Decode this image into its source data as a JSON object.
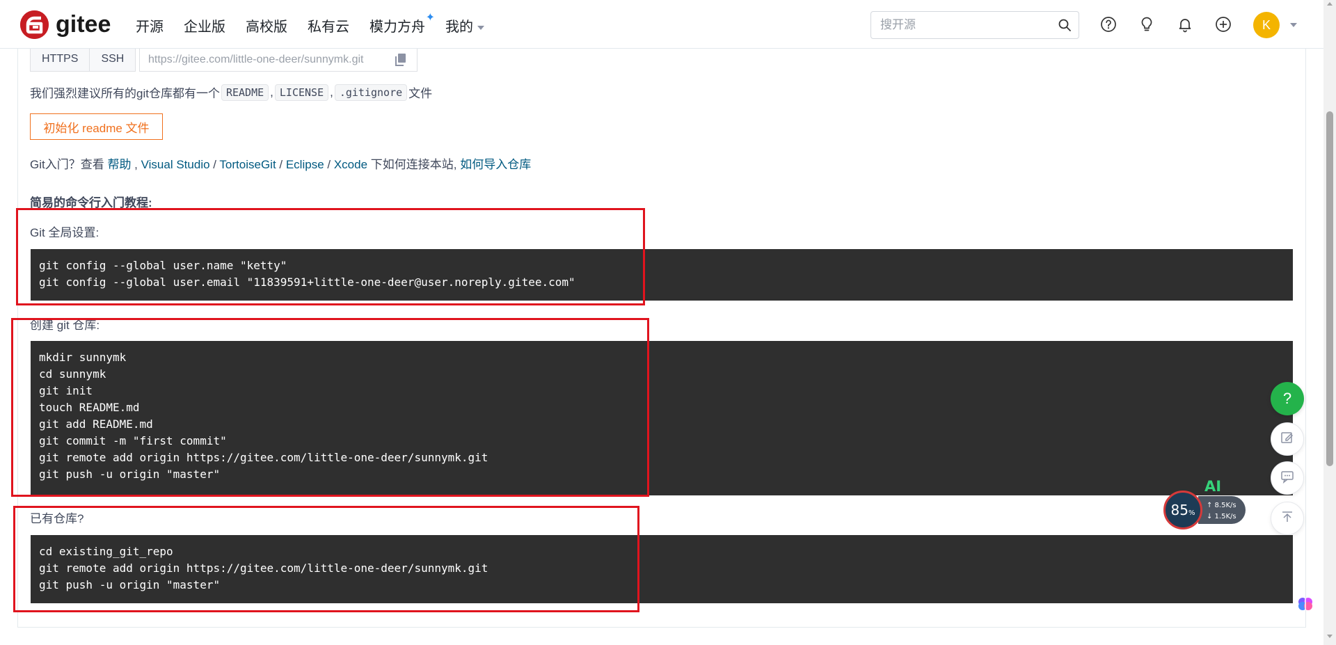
{
  "header": {
    "logo_text": "gitee",
    "nav": [
      {
        "label": "开源"
      },
      {
        "label": "企业版"
      },
      {
        "label": "高校版"
      },
      {
        "label": "私有云"
      },
      {
        "label": "模力方舟",
        "badge": "✦"
      },
      {
        "label": "我的"
      }
    ],
    "search_placeholder": "搜开源",
    "avatar_letter": "K"
  },
  "clone": {
    "https_label": "HTTPS",
    "ssh_label": "SSH",
    "url": "https://gitee.com/little-one-deer/sunnymk.git"
  },
  "recommend": {
    "prefix": "我们强烈建议所有的git仓库都有一个",
    "file1": "README",
    "sep1": ",",
    "file2": "LICENSE",
    "sep2": ",",
    "file3": ".gitignore",
    "suffix": "文件"
  },
  "init_button": "初始化 readme 文件",
  "links": {
    "prefix": "Git入门？查看 ",
    "help": "帮助",
    "sep0": " , ",
    "vs": "Visual Studio",
    "sep1": " / ",
    "tortoise": "TortoiseGit",
    "sep2": " / ",
    "eclipse": "Eclipse",
    "sep3": " / ",
    "xcode": "Xcode",
    "middle": " 下如何连接本站, ",
    "import": "如何导入仓库"
  },
  "tutorial": {
    "title": "简易的命令行入门教程:",
    "global_label": "Git 全局设置:",
    "global_code": [
      "git config --global user.name \"ketty\"",
      "git config --global user.email \"11839591+little-one-deer@user.noreply.gitee.com\""
    ],
    "create_label": "创建 git 仓库:",
    "create_code": [
      "mkdir sunnymk",
      "cd sunnymk",
      "git init",
      "touch README.md",
      "git add README.md",
      "git commit -m \"first commit\"",
      "git remote add origin https://gitee.com/little-one-deer/sunnymk.git",
      "git push -u origin \"master\""
    ],
    "existing_label": "已有仓库?",
    "existing_code": [
      "cd existing_git_repo",
      "git remote add origin https://gitee.com/little-one-deer/sunnymk.git",
      "git push -u origin \"master\""
    ]
  },
  "float": {
    "help": "?",
    "ai_label": "AI",
    "cpu_percent": "85",
    "cpu_unit": "%",
    "upload_speed": "↑ 8.5K/s",
    "download_speed": "↓ 1.5K/s"
  },
  "colors": {
    "brand_red": "#c71d23",
    "accent_orange": "#f0701d",
    "link_blue": "#005980",
    "annotation_red": "#e0141e",
    "code_bg": "#2f2f2f"
  }
}
